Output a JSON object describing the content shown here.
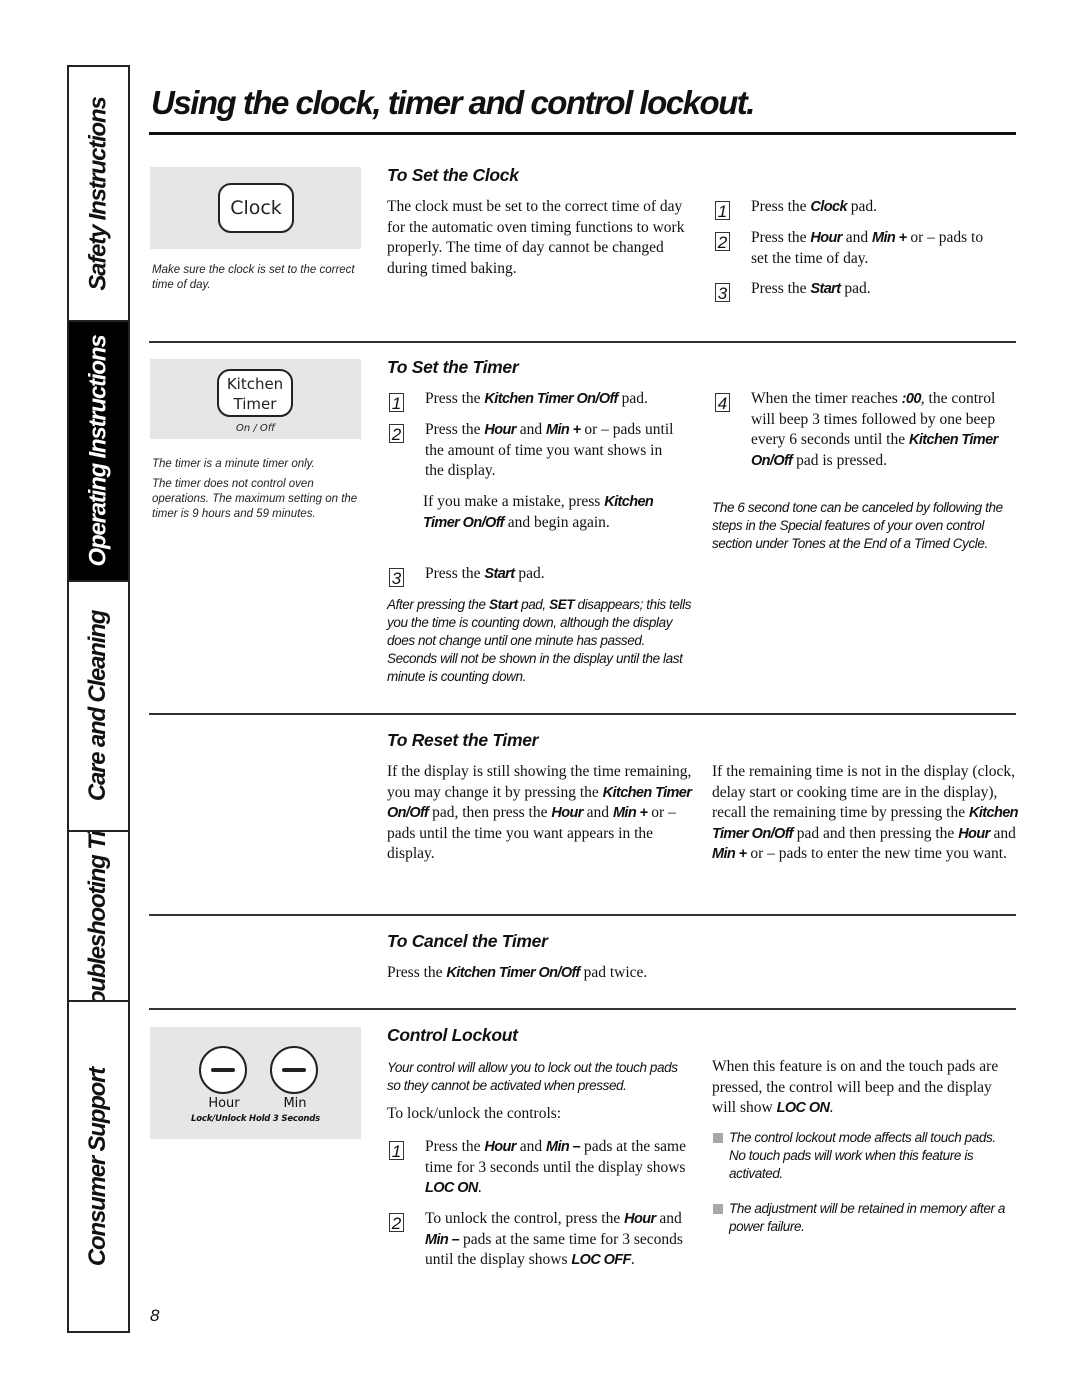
{
  "sidebar": {
    "tabs": [
      {
        "label": "Safety Instructions",
        "active": false
      },
      {
        "label": "Operating Instructions",
        "active": true
      },
      {
        "label": "Care and Cleaning",
        "active": false
      },
      {
        "label": "Troubleshooting Tips",
        "active": false
      },
      {
        "label": "Consumer Support",
        "active": false
      }
    ]
  },
  "page": {
    "title": "Using the clock, timer and control lockout.",
    "number": "8"
  },
  "clock_panel": {
    "pad_label": "Clock",
    "caption": "Make sure the clock is set to the correct time of day."
  },
  "timer_panel": {
    "pad_line1": "Kitchen",
    "pad_line2": "Timer",
    "sub_label": "On / Off",
    "caption1": "The timer is a minute timer only.",
    "caption2": "The timer does not control oven operations. The maximum setting on the timer is 9 hours and 59 minutes."
  },
  "lock_panel": {
    "hour_label": "Hour",
    "min_label": "Min",
    "hold_label": "Lock/Unlock Hold 3 Seconds"
  },
  "set_clock": {
    "heading": "To Set the Clock",
    "body": "The clock must be set to the correct time of day for the automatic oven timing functions to work properly. The time of day cannot be changed during timed baking.",
    "steps": [
      {
        "n": "1",
        "pre": "Press the ",
        "key": "Clock",
        "post": " pad."
      },
      {
        "n": "2",
        "pre": "Press the ",
        "key": "Hour",
        "mid": " and ",
        "key2": "Min +",
        "post": " or – pads to set the time of day."
      },
      {
        "n": "3",
        "pre": "Press the ",
        "key": "Start",
        "post": " pad."
      }
    ]
  },
  "set_timer": {
    "heading": "To Set the Timer",
    "steps": [
      {
        "n": "1",
        "pre": "Press the ",
        "key": "Kitchen Timer On/Off",
        "post": " pad."
      },
      {
        "n": "2",
        "pre": "Press the ",
        "key": "Hour",
        "mid": " and ",
        "key2": "Min +",
        "post": " or – pads until the amount of time you want shows in the display."
      },
      {
        "n": "3",
        "pre": "Press the ",
        "key": "Start",
        "post": " pad."
      },
      {
        "n": "4",
        "pre": "When the timer reaches ",
        "key": ":00",
        "mid": ", the control will beep 3 times followed by one beep every 6 seconds until the ",
        "key2": "Kitchen Timer On/Off",
        "post": " pad is pressed."
      }
    ],
    "mistake_pre": "If you make a mistake, press ",
    "mistake_key": "Kitchen Timer On/Off",
    "mistake_post": " and begin again.",
    "note_pre": "After pressing the ",
    "note_key1": "Start",
    "note_mid": " pad, ",
    "note_key2": "SET",
    "note_post": " disappears; this tells you the time is counting down, although the display does not change until one minute has passed. Seconds will not be shown in the display until the last minute is counting down.",
    "tone_note": "The 6 second tone can be canceled by following the steps in the Special features of your oven control section under Tones at the End of a Timed Cycle."
  },
  "reset_timer": {
    "heading": "To Reset the Timer",
    "left": {
      "a": "If the display is still showing the time remaining, you may change it by pressing the ",
      "k1": "Kitchen Timer On/Off",
      "b": " pad, then press the ",
      "k2": "Hour",
      "c": " and ",
      "k3": "Min +",
      "d": " or – pads until the time you want appears in the display."
    },
    "right": {
      "a": "If the remaining time is not in the display (clock, delay start or cooking time are in the display), recall the remaining time by pressing the ",
      "k1": "Kitchen Timer On/Off",
      "b": " pad and then pressing the ",
      "k2": "Hour",
      "c": " and ",
      "k3": "Min +",
      "d": " or – pads to enter the new time you want."
    }
  },
  "cancel_timer": {
    "heading": "To Cancel the Timer",
    "pre": "Press the ",
    "key": "Kitchen Timer On/Off",
    "post": " pad twice."
  },
  "lockout": {
    "heading": "Control Lockout",
    "intro": "Your control will allow you to lock out the touch pads so they cannot be activated when pressed.",
    "lead": "To lock/unlock the controls:",
    "steps": [
      {
        "n": "1",
        "pre": "Press the ",
        "key": "Hour",
        "mid": " and ",
        "key2": "Min –",
        "mid2": " pads at the same time for 3 seconds until the display shows ",
        "key3": "LOC ON",
        "post": "."
      },
      {
        "n": "2",
        "pre": "To unlock the control, press the ",
        "key": "Hour",
        "mid": " and ",
        "key2": "Min –",
        "mid2": " pads at the same time for 3 seconds until the display shows ",
        "key3": "LOC OFF",
        "post": "."
      }
    ],
    "right_pre": "When this feature is on and the touch pads are pressed, the control will beep and the display will show ",
    "right_key": "LOC ON",
    "right_post": ".",
    "bullets": [
      "The control lockout mode affects all touch pads. No touch pads will work when this feature is activated.",
      "The adjustment will be retained in memory after a power failure."
    ]
  }
}
